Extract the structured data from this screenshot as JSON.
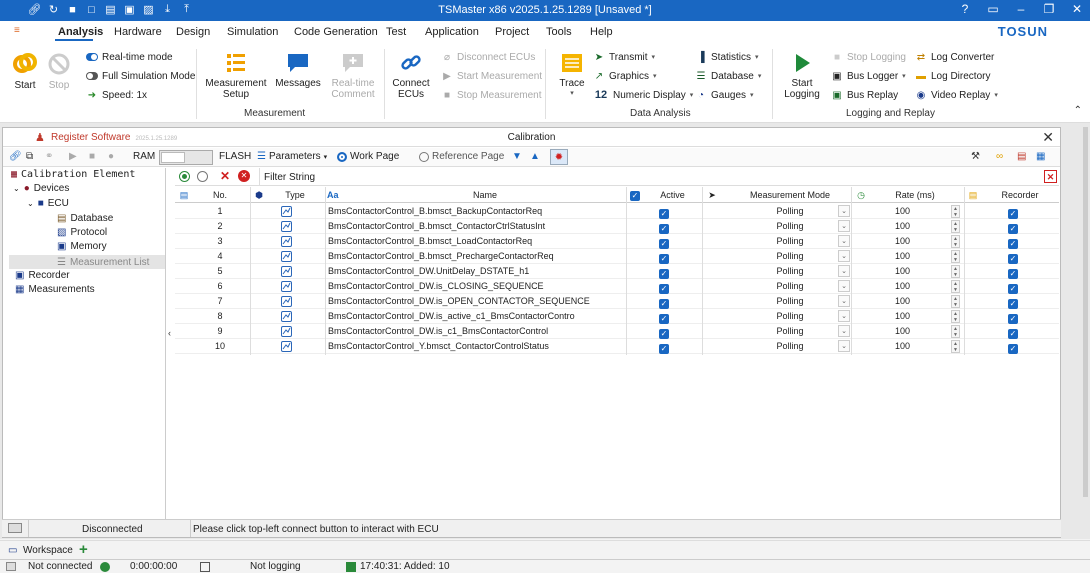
{
  "window": {
    "title": "TSMaster x86 v2025.1.25.1289 [Unsaved *]"
  },
  "menu": {
    "items": [
      "Analysis",
      "Hardware",
      "Design",
      "Simulation",
      "Code Generation",
      "Test",
      "Application",
      "Project",
      "Tools",
      "Help"
    ],
    "brand": "TOSUN"
  },
  "ribbon": {
    "start": "Start",
    "stop": "Stop",
    "realtime_mode": "Real-time mode",
    "full_sim_mode": "Full Simulation Mode",
    "speed": "Speed: 1x",
    "measurement_setup": "Measurement Setup",
    "messages": "Messages",
    "realtime_comment": "Real-time Comment",
    "measurement_group": "Measurement",
    "connect_ecus": "Connect ECUs",
    "disconnect_ecus": "Disconnect ECUs",
    "start_measurement": "Start Measurement",
    "stop_measurement": "Stop Measurement",
    "trace": "Trace",
    "transmit": "Transmit",
    "graphics": "Graphics",
    "numeric_display": "Numeric Display",
    "statistics": "Statistics",
    "database": "Database",
    "gauges": "Gauges",
    "data_analysis_group": "Data Analysis",
    "start_logging": "Start Logging",
    "stop_logging": "Stop Logging",
    "bus_logger": "Bus Logger",
    "bus_replay": "Bus Replay",
    "log_converter": "Log Converter",
    "log_directory": "Log Directory",
    "video_replay": "Video Replay",
    "logging_group": "Logging and Replay"
  },
  "panel": {
    "register": "Register Software",
    "register_ver": "2025.1.25.1289",
    "title": "Calibration",
    "ram": "RAM",
    "flash": "FLASH",
    "parameters": "Parameters",
    "work_page": "Work Page",
    "reference_page": "Reference Page",
    "filter_label": "Filter String"
  },
  "tree": {
    "header": "Calibration Element",
    "devices": "Devices",
    "ecu": "ECU",
    "database": "Database",
    "protocol": "Protocol",
    "memory": "Memory",
    "measurement_list": "Measurement List",
    "recorder": "Recorder",
    "measurements": "Measurements"
  },
  "grid": {
    "columns": {
      "no": "No.",
      "type": "Type",
      "aa": "Aa",
      "name": "Name",
      "active": "Active",
      "mode": "Measurement Mode",
      "rate": "Rate (ms)",
      "recorder": "Recorder"
    },
    "rows": [
      {
        "no": "1",
        "name": "BmsContactorControl_B.bmsct_BackupContactorReq",
        "mode": "Polling",
        "rate": "100"
      },
      {
        "no": "2",
        "name": "BmsContactorControl_B.bmsct_ContactorCtrlStatusInt",
        "mode": "Polling",
        "rate": "100"
      },
      {
        "no": "3",
        "name": "BmsContactorControl_B.bmsct_LoadContactorReq",
        "mode": "Polling",
        "rate": "100"
      },
      {
        "no": "4",
        "name": "BmsContactorControl_B.bmsct_PrechargeContactorReq",
        "mode": "Polling",
        "rate": "100"
      },
      {
        "no": "5",
        "name": "BmsContactorControl_DW.UnitDelay_DSTATE_h1",
        "mode": "Polling",
        "rate": "100"
      },
      {
        "no": "6",
        "name": "BmsContactorControl_DW.is_CLOSING_SEQUENCE",
        "mode": "Polling",
        "rate": "100"
      },
      {
        "no": "7",
        "name": "BmsContactorControl_DW.is_OPEN_CONTACTOR_SEQUENCE",
        "mode": "Polling",
        "rate": "100"
      },
      {
        "no": "8",
        "name": "BmsContactorControl_DW.is_active_c1_BmsContactorContro",
        "mode": "Polling",
        "rate": "100"
      },
      {
        "no": "9",
        "name": "BmsContactorControl_DW.is_c1_BmsContactorControl",
        "mode": "Polling",
        "rate": "100"
      },
      {
        "no": "10",
        "name": "BmsContactorControl_Y.bmsct_ContactorControlStatus",
        "mode": "Polling",
        "rate": "100"
      }
    ]
  },
  "inner_status": {
    "state": "Disconnected",
    "hint": "Please click top-left connect button to interact with ECU"
  },
  "workspace": {
    "label": "Workspace"
  },
  "statusbar": {
    "connection": "Not connected",
    "time": "0:00:00:00",
    "logging": "Not logging",
    "event": "17:40:31: Added: 10"
  },
  "colors": {
    "accent": "#1967c2",
    "title_bar": "#1967c2",
    "register": "#c0392b"
  }
}
